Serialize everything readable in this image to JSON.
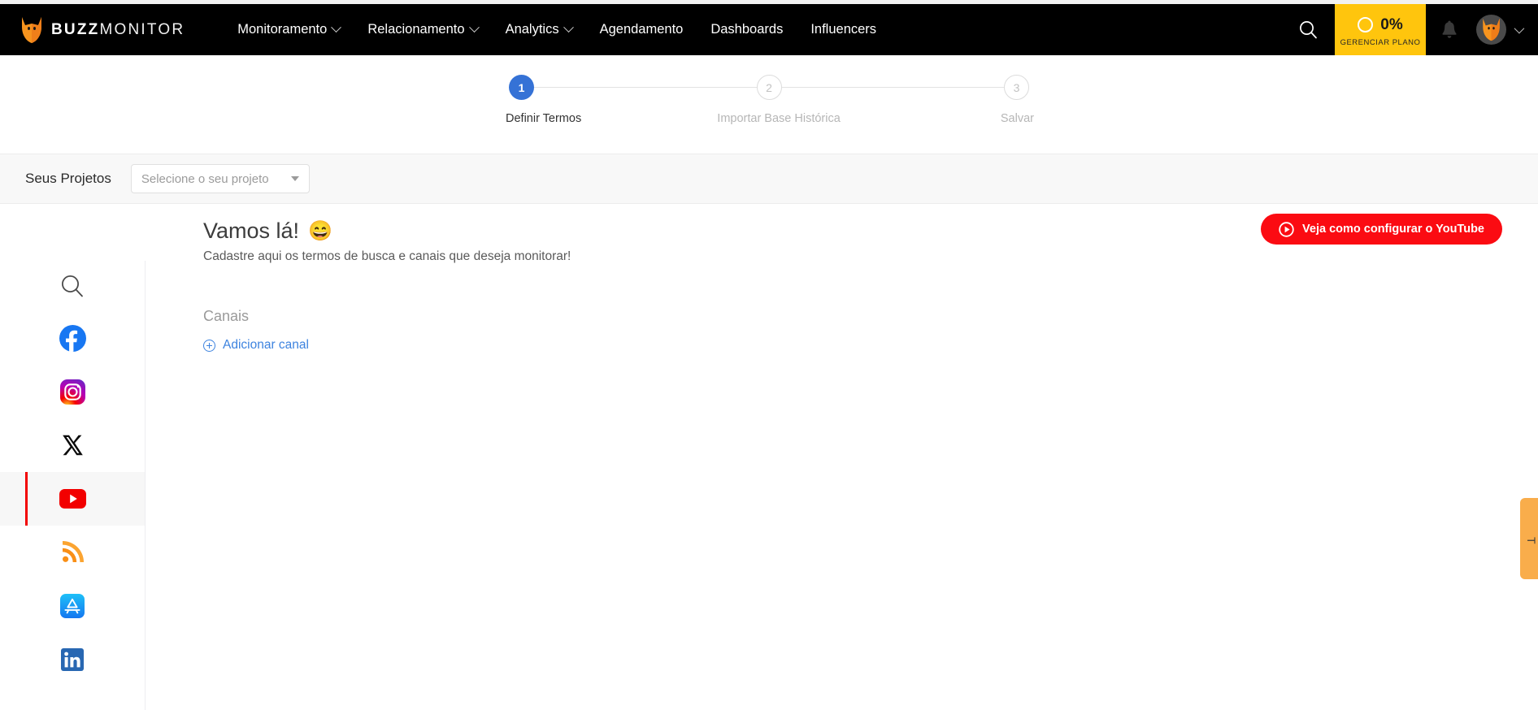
{
  "header": {
    "brand_bold": "BUZZ",
    "brand_light": "MONITOR",
    "logo_icon": "fox-logo-icon",
    "nav": [
      {
        "label": "Monitoramento",
        "has_caret": true
      },
      {
        "label": "Relacionamento",
        "has_caret": true
      },
      {
        "label": "Analytics",
        "has_caret": true
      },
      {
        "label": "Agendamento",
        "has_caret": false
      },
      {
        "label": "Dashboards",
        "has_caret": false
      },
      {
        "label": "Influencers",
        "has_caret": false
      }
    ],
    "search_icon": "search-icon",
    "plan": {
      "percent": "0%",
      "label": "GERENCIAR PLANO",
      "bg_color": "#ffc50d"
    },
    "bell_icon": "bell-icon",
    "avatar_icon": "fox-avatar-icon",
    "avatar_caret_icon": "chevron-down-icon"
  },
  "stepper": {
    "steps": [
      {
        "number": "1",
        "label": "Definir Termos",
        "state": "active"
      },
      {
        "number": "2",
        "label": "Importar Base Histórica",
        "state": "idle"
      },
      {
        "number": "3",
        "label": "Salvar",
        "state": "idle"
      }
    ],
    "active_color": "#3572d6"
  },
  "project_bar": {
    "label": "Seus Projetos",
    "select_placeholder": "Selecione o seu projeto",
    "select_value": ""
  },
  "sidebar": {
    "items": [
      {
        "name": "search",
        "icon": "search-icon",
        "active": false
      },
      {
        "name": "facebook",
        "icon": "facebook-icon",
        "active": false
      },
      {
        "name": "instagram",
        "icon": "instagram-icon",
        "active": false
      },
      {
        "name": "twitter-x",
        "icon": "x-twitter-icon",
        "active": false
      },
      {
        "name": "youtube",
        "icon": "youtube-icon",
        "active": true
      },
      {
        "name": "rss",
        "icon": "rss-icon",
        "active": false
      },
      {
        "name": "appstore",
        "icon": "appstore-icon",
        "active": false
      },
      {
        "name": "linkedin",
        "icon": "linkedin-icon",
        "active": false
      }
    ],
    "active_indicator_color": "#f20000"
  },
  "main": {
    "heading": "Vamos lá!",
    "heading_emoji": "😄",
    "subtitle": "Cadastre aqui os termos de busca e canais que deseja monitorar!",
    "section_title": "Canais",
    "add_channel_label": "Adicionar canal",
    "add_channel_icon": "plus-circle-icon",
    "link_color": "#3d83df"
  },
  "cta": {
    "label": "Veja como configurar o YouTube",
    "icon": "play-circle-icon",
    "bg_color": "#fb0b12"
  },
  "edge_tab": {
    "label": "T",
    "bg_color": "#f9ad4b"
  }
}
